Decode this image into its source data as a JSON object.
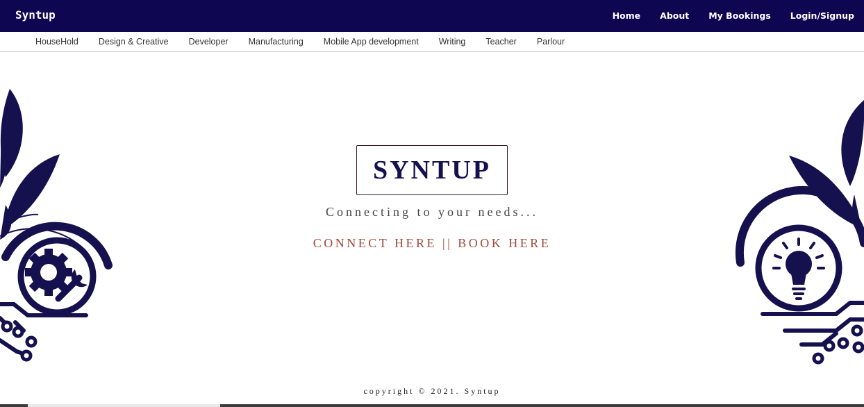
{
  "header": {
    "brand": "Syntup",
    "nav": [
      {
        "label": "Home"
      },
      {
        "label": "About"
      },
      {
        "label": "My Bookings"
      },
      {
        "label": "Login/Signup"
      }
    ]
  },
  "categories": [
    {
      "label": "HouseHold"
    },
    {
      "label": "Design & Creative"
    },
    {
      "label": "Developer"
    },
    {
      "label": "Manufacturing"
    },
    {
      "label": "Mobile App development"
    },
    {
      "label": "Writing"
    },
    {
      "label": "Teacher"
    },
    {
      "label": "Parlour"
    }
  ],
  "hero": {
    "title": "SYNTUP",
    "tagline": "Connecting to your needs...",
    "connect_label": "CONNECT HERE",
    "separator": "||",
    "book_label": "BOOK HERE"
  },
  "footer": {
    "copyright": "copyright © 2021. Syntup"
  },
  "colors": {
    "navbar": "#0f0652",
    "decoration": "#15104e",
    "cta": "#a0493a"
  },
  "icons": {
    "left_decoration": "gear-wrench-icon",
    "right_decoration": "lightbulb-icon"
  }
}
